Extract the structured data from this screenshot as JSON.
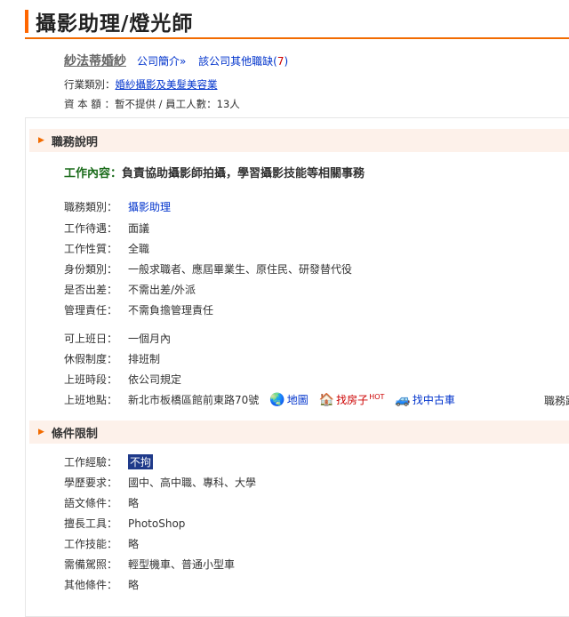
{
  "page": {
    "title": "攝影助理/燈光師"
  },
  "company": {
    "name": "紗法蒂婚紗",
    "intro_link": "公司簡介»",
    "other_jobs_link": "該公司其他職缺(",
    "other_jobs_count": "7",
    "other_jobs_close": ")"
  },
  "industry": {
    "label": "行業類別：",
    "value": "婚紗攝影及美髮美容業"
  },
  "capital": {
    "label": "資 本 額 ：",
    "value": "暫不提供 / 員工人數：13人"
  },
  "sections": {
    "job": "職務說明",
    "conditions": "條件限制"
  },
  "description": {
    "label": "工作內容：",
    "value": "負責協助攝影師拍攝，學習攝影技能等相關事務"
  },
  "job_rows": [
    {
      "label": "職務類別：",
      "value": "攝影助理"
    },
    {
      "label": "工作待遇：",
      "value": "面議"
    },
    {
      "label": "工作性質：",
      "value": "全職"
    },
    {
      "label": "身份類別：",
      "value": "一般求職者、應屆畢業生、原住民、研發替代役"
    },
    {
      "label": "是否出差：",
      "value": "不需出差/外派"
    },
    {
      "label": "管理責任：",
      "value": "不需負擔管理責任"
    },
    {
      "label": "可上班日：",
      "value": "一個月內"
    },
    {
      "label": "休假制度：",
      "value": "排班制"
    },
    {
      "label": "上班時段：",
      "value": "依公司規定"
    },
    {
      "label": "上班地點：",
      "value": "新北市板橋區館前東路70號"
    }
  ],
  "location_links": {
    "map": "地圖",
    "house": "找房子",
    "hot": "HOT",
    "car": "找中古車",
    "cutoff": "職務跟"
  },
  "condition_rows": [
    {
      "label": "工作經驗：",
      "value": "不拘"
    },
    {
      "label": "學歷要求：",
      "value": "國中、高中職、專科、大學"
    },
    {
      "label": "語文條件：",
      "value": "略"
    },
    {
      "label": "擅長工具：",
      "value": "PhotoShop"
    },
    {
      "label": "工作技能：",
      "value": "略"
    },
    {
      "label": "需備駕照：",
      "value": "輕型機車、普通小型車"
    },
    {
      "label": "其他條件：",
      "value": "略"
    }
  ],
  "colors": {
    "accent": "#f26b00",
    "link": "#0033cc",
    "section_bg": "#fdf1ea"
  }
}
